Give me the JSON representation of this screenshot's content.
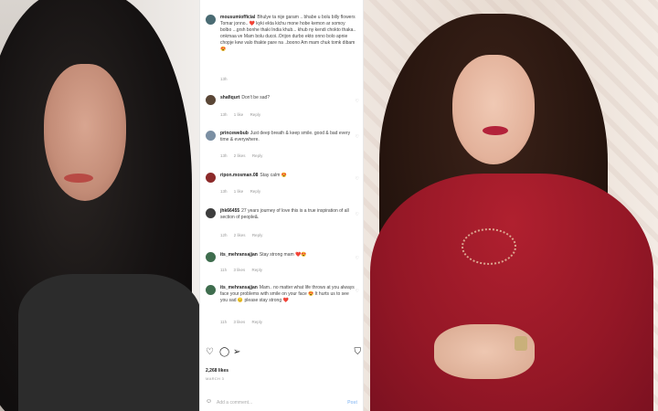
{
  "comments": [
    {
      "user": "mousumiofficial",
      "text": "Bhulye ta nije garam .. bhabe u bolu billy flowers Tomar jonno.. ❤️ kyki ekta kichu mone hobe kemon ar somoy bolbo ...grsh bonhe thaki India khub... khub ny kendi chokto thaka.. onkmaa ve Mam bolu ducoi..Orijon durbo ekto onno bolo apnie chopje kew valo thakte pare na ..boono Am mam chuk tomk dibam 😍",
      "time": "13h",
      "likes": "",
      "reply": ""
    },
    {
      "user": "shafiqurt",
      "text": "Don't be sad?",
      "time": "13h",
      "likes": "1 like",
      "reply": "Reply"
    },
    {
      "user": "princewebub",
      "text": "Just deep breath & keep smile. good & bad every time & everywhere.",
      "time": "13h",
      "likes": "2 likes",
      "reply": "Reply"
    },
    {
      "user": "ripon.mosman.08",
      "text": "Stay calm 😍",
      "time": "13h",
      "likes": "1 like",
      "reply": "Reply"
    },
    {
      "user": "jhk66455",
      "text": "27 years journey of love this is a true inspiration of all section of people&.",
      "time": "12h",
      "likes": "2 likes",
      "reply": "Reply"
    },
    {
      "user": "its_mehransajjan",
      "text": "Stay strong mam ❤️😍",
      "time": "11h",
      "likes": "3 likes",
      "reply": "Reply"
    },
    {
      "user": "its_mehransajjan",
      "text": "Mam.. no matter what life throws at you always face your problems with smile on your face 😍 It hurts us to see you sad 😔 please stay strong ❤️",
      "time": "11h",
      "likes": "3 likes",
      "reply": "Reply"
    }
  ],
  "likes_count": "2,268 likes",
  "post_date": "MARCH 3",
  "add_comment_placeholder": "Add a comment...",
  "post_label": "Post",
  "icons": {
    "like": "heart-icon",
    "comment": "comment-icon",
    "share": "share-icon",
    "save": "bookmark-icon",
    "emoji": "emoji-icon"
  },
  "colors": {
    "post_button": "#9fc7f5",
    "dress": "#941726"
  }
}
